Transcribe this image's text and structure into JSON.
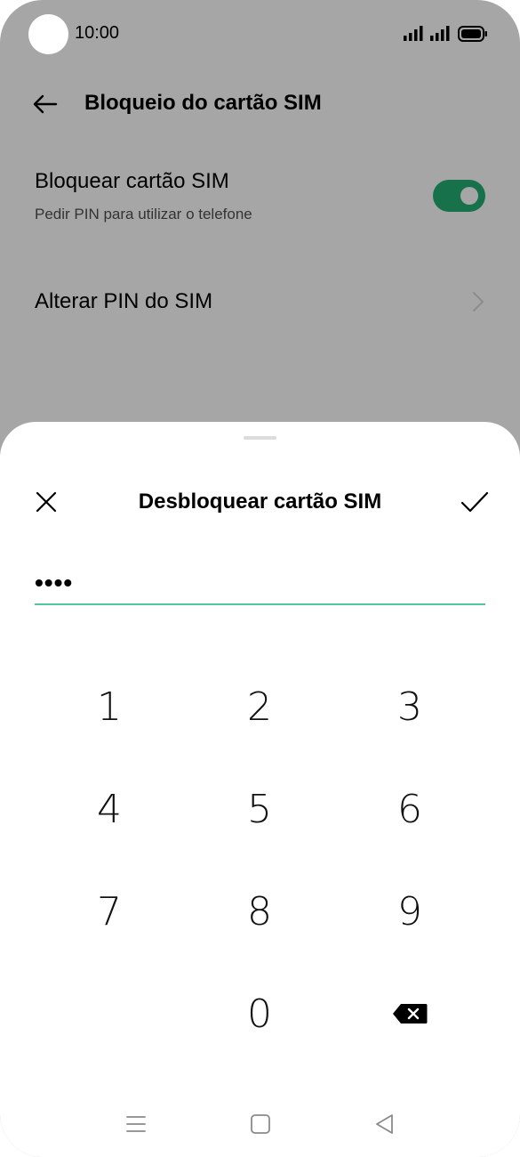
{
  "status_bar": {
    "time": "10:00"
  },
  "settings": {
    "title": "Bloqueio do cartão SIM",
    "lock_sim": {
      "title": "Bloquear cartão SIM",
      "subtitle": "Pedir PIN para utilizar o telefone",
      "enabled": true
    },
    "change_pin": {
      "title": "Alterar PIN do SIM"
    }
  },
  "sheet": {
    "title": "Desbloquear cartão SIM",
    "pin_value": "••••",
    "keypad": [
      "1",
      "2",
      "3",
      "4",
      "5",
      "6",
      "7",
      "8",
      "9",
      "0"
    ]
  },
  "colors": {
    "accent": "#17714a",
    "input_line": "#56c59c",
    "dim_background": "#a6a6a6"
  }
}
